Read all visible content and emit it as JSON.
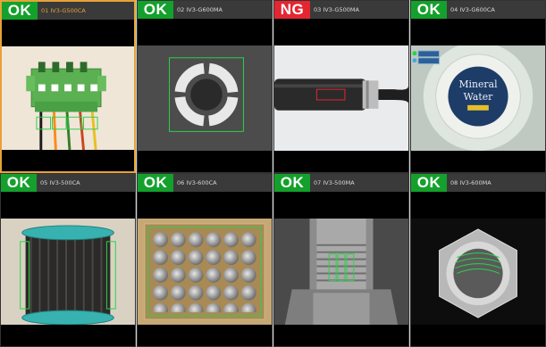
{
  "colors": {
    "ok": "#14a02c",
    "ng": "#e32631",
    "selected_border": "#e6a238",
    "tool_outline": "#2bd14a"
  },
  "cells": [
    {
      "status": "OK",
      "name": "01  IV3-G500CA",
      "scene": "green-terminal-block-connector",
      "selected": true
    },
    {
      "status": "OK",
      "name": "02  IV3-G600MA",
      "scene": "ring-gasket",
      "selected": false
    },
    {
      "status": "NG",
      "name": "03  IV3-G500MA",
      "scene": "cable-connector-plug",
      "selected": false
    },
    {
      "status": "OK",
      "name": "04  IV3-G600CA",
      "scene": "bottle-cap-label",
      "label_line1": "Mineral",
      "label_line2": "Water",
      "selected": false
    },
    {
      "status": "OK",
      "name": "05  IV3-500CA",
      "scene": "wire-coil-spool",
      "selected": false
    },
    {
      "status": "OK",
      "name": "06  IV3-600CA",
      "scene": "battery-tray",
      "selected": false
    },
    {
      "status": "OK",
      "name": "07  IV3-500MA",
      "scene": "threaded-pipe-fitting",
      "selected": false
    },
    {
      "status": "OK",
      "name": "08  IV3-600MA",
      "scene": "hex-nut",
      "selected": false
    }
  ]
}
